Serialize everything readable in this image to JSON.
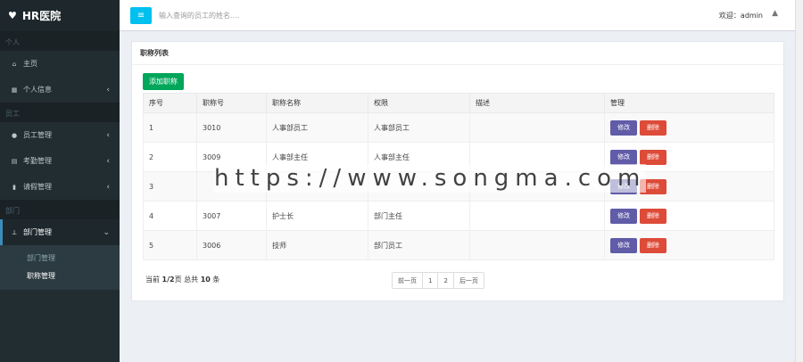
{
  "brand": {
    "logo_icon": "heart-pulse-icon",
    "title": "HR医院"
  },
  "sidebar": {
    "sections": [
      {
        "header": "个人",
        "items": [
          {
            "icon": "home-icon",
            "label": "主页",
            "chevron": false
          },
          {
            "icon": "calendar-icon",
            "label": "个人信息",
            "chevron": true
          }
        ]
      },
      {
        "header": "员工",
        "items": [
          {
            "icon": "user-icon",
            "label": "员工管理",
            "chevron": true
          },
          {
            "icon": "table-icon",
            "label": "考勤管理",
            "chevron": true
          },
          {
            "icon": "bookmark-icon",
            "label": "请假管理",
            "chevron": true
          }
        ]
      },
      {
        "header": "部门",
        "items": [
          {
            "icon": "sitemap-icon",
            "label": "部门管理",
            "chevron": true,
            "active": true
          }
        ]
      }
    ],
    "submenu": [
      {
        "label": "部门管理"
      },
      {
        "label": "职称管理",
        "current": true
      }
    ]
  },
  "header": {
    "toggle_icon": "menu-icon",
    "search_placeholder": "输入查询的员工的姓名....",
    "welcome": "欢迎：admin",
    "user_icon": "user-icon"
  },
  "panel": {
    "title": "职称列表",
    "add_button": "添加职称",
    "columns": [
      "序号",
      "职称号",
      "职称名称",
      "权限",
      "描述",
      "管理"
    ],
    "rows": [
      {
        "index": "1",
        "code": "3010",
        "name": "人事部员工",
        "permission": "人事部员工",
        "desc": ""
      },
      {
        "index": "2",
        "code": "3009",
        "name": "人事部主任",
        "permission": "人事部主任",
        "desc": ""
      },
      {
        "index": "3",
        "code": "",
        "name": "",
        "permission": "",
        "desc": ""
      },
      {
        "index": "4",
        "code": "3007",
        "name": "护士长",
        "permission": "部门主任",
        "desc": ""
      },
      {
        "index": "5",
        "code": "3006",
        "name": "技师",
        "permission": "部门员工",
        "desc": ""
      }
    ],
    "edit_label": "修改",
    "delete_label": "删除"
  },
  "pagination": {
    "info_prefix": "当前",
    "current": "1",
    "sep": "/",
    "total_pages": "2",
    "info_mid": "页 总共",
    "total_count": "10",
    "info_suffix": "条",
    "prev": "前一页",
    "pages": [
      "1",
      "2"
    ],
    "next": "后一页"
  },
  "watermark": "https://www.songma.com",
  "colors": {
    "sidebar": "#222d32",
    "accent_blue": "#00c0ef",
    "add_green": "#00a65a",
    "edit_purple": "#605ca8",
    "delete_red": "#dd4b39"
  }
}
